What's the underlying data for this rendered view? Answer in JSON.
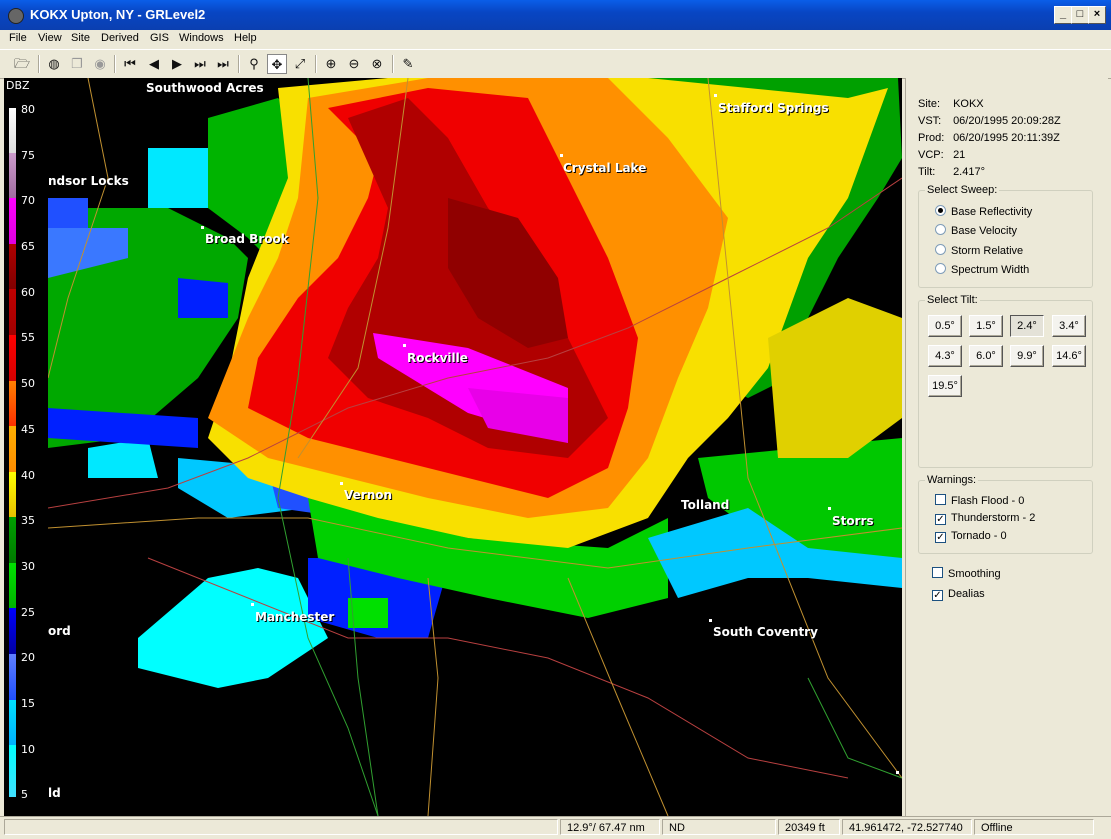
{
  "window": {
    "title": "KOKX Upton, NY - GRLevel2",
    "minimize": "_",
    "maximize": "□",
    "close": "×"
  },
  "menu": [
    "File",
    "View",
    "Site",
    "Derived",
    "GIS",
    "Windows",
    "Help"
  ],
  "toolbar": {
    "icons": [
      "open-folder-icon",
      "globe-icon",
      "copy-icon",
      "camera-icon",
      "first-frame-icon",
      "prev-frame-icon",
      "play-icon",
      "next-frame-icon",
      "last-frame-icon",
      "zoom-icon",
      "pan-icon",
      "measure-icon",
      "zoom-in-icon",
      "zoom-out-icon",
      "zoom-reset-icon",
      "pin-icon"
    ],
    "active_tool": "pan-icon"
  },
  "legend": {
    "label": "DBZ",
    "ticks": [
      "80",
      "75",
      "70",
      "65",
      "60",
      "55",
      "50",
      "45",
      "40",
      "35",
      "30",
      "25",
      "20",
      "15",
      "10",
      "5"
    ]
  },
  "map": {
    "cities": [
      {
        "name": "Southwood Acres"
      },
      {
        "name": "Stafford Springs"
      },
      {
        "name": "ndsor Locks"
      },
      {
        "name": "Crystal Lake"
      },
      {
        "name": "Broad Brook"
      },
      {
        "name": "Rockville"
      },
      {
        "name": "Vernon"
      },
      {
        "name": "Tolland"
      },
      {
        "name": "Storrs"
      },
      {
        "name": "Manchester"
      },
      {
        "name": "ord"
      },
      {
        "name": "South Coventry"
      },
      {
        "name": "ld"
      }
    ]
  },
  "info": {
    "site_label": "Site:",
    "site": "KOKX",
    "vst_label": "VST:",
    "vst": "06/20/1995  20:09:28Z",
    "prod_label": "Prod:",
    "prod": "06/20/1995  20:11:39Z",
    "vcp_label": "VCP:",
    "vcp": "21",
    "tilt_label": "Tilt:",
    "tilt": "2.417°"
  },
  "sweep": {
    "title": "Select Sweep:",
    "options": [
      "Base Reflectivity",
      "Base Velocity",
      "Storm Relative",
      "Spectrum Width"
    ],
    "selected": "Base Reflectivity"
  },
  "tilts": {
    "title": "Select Tilt:",
    "values": [
      "0.5°",
      "1.5°",
      "2.4°",
      "3.4°",
      "4.3°",
      "6.0°",
      "9.9°",
      "14.6°",
      "19.5°"
    ],
    "selected": "2.4°"
  },
  "warnings": {
    "title": "Warnings:",
    "items": [
      {
        "label": "Flash Flood - 0",
        "checked": false
      },
      {
        "label": "Thunderstorm - 2",
        "checked": true
      },
      {
        "label": "Tornado - 0",
        "checked": true
      }
    ]
  },
  "options": [
    {
      "label": "Smoothing",
      "checked": false
    },
    {
      "label": "Dealias",
      "checked": true
    }
  ],
  "status": {
    "polar": "12.9°/ 67.47 nm",
    "value": "ND",
    "height": "20349 ft",
    "latlon": "41.961472, -72.527740",
    "state": "Offline"
  },
  "colors": {
    "xp_blue": "#0a5ee8",
    "panel": "#ece9d8"
  }
}
